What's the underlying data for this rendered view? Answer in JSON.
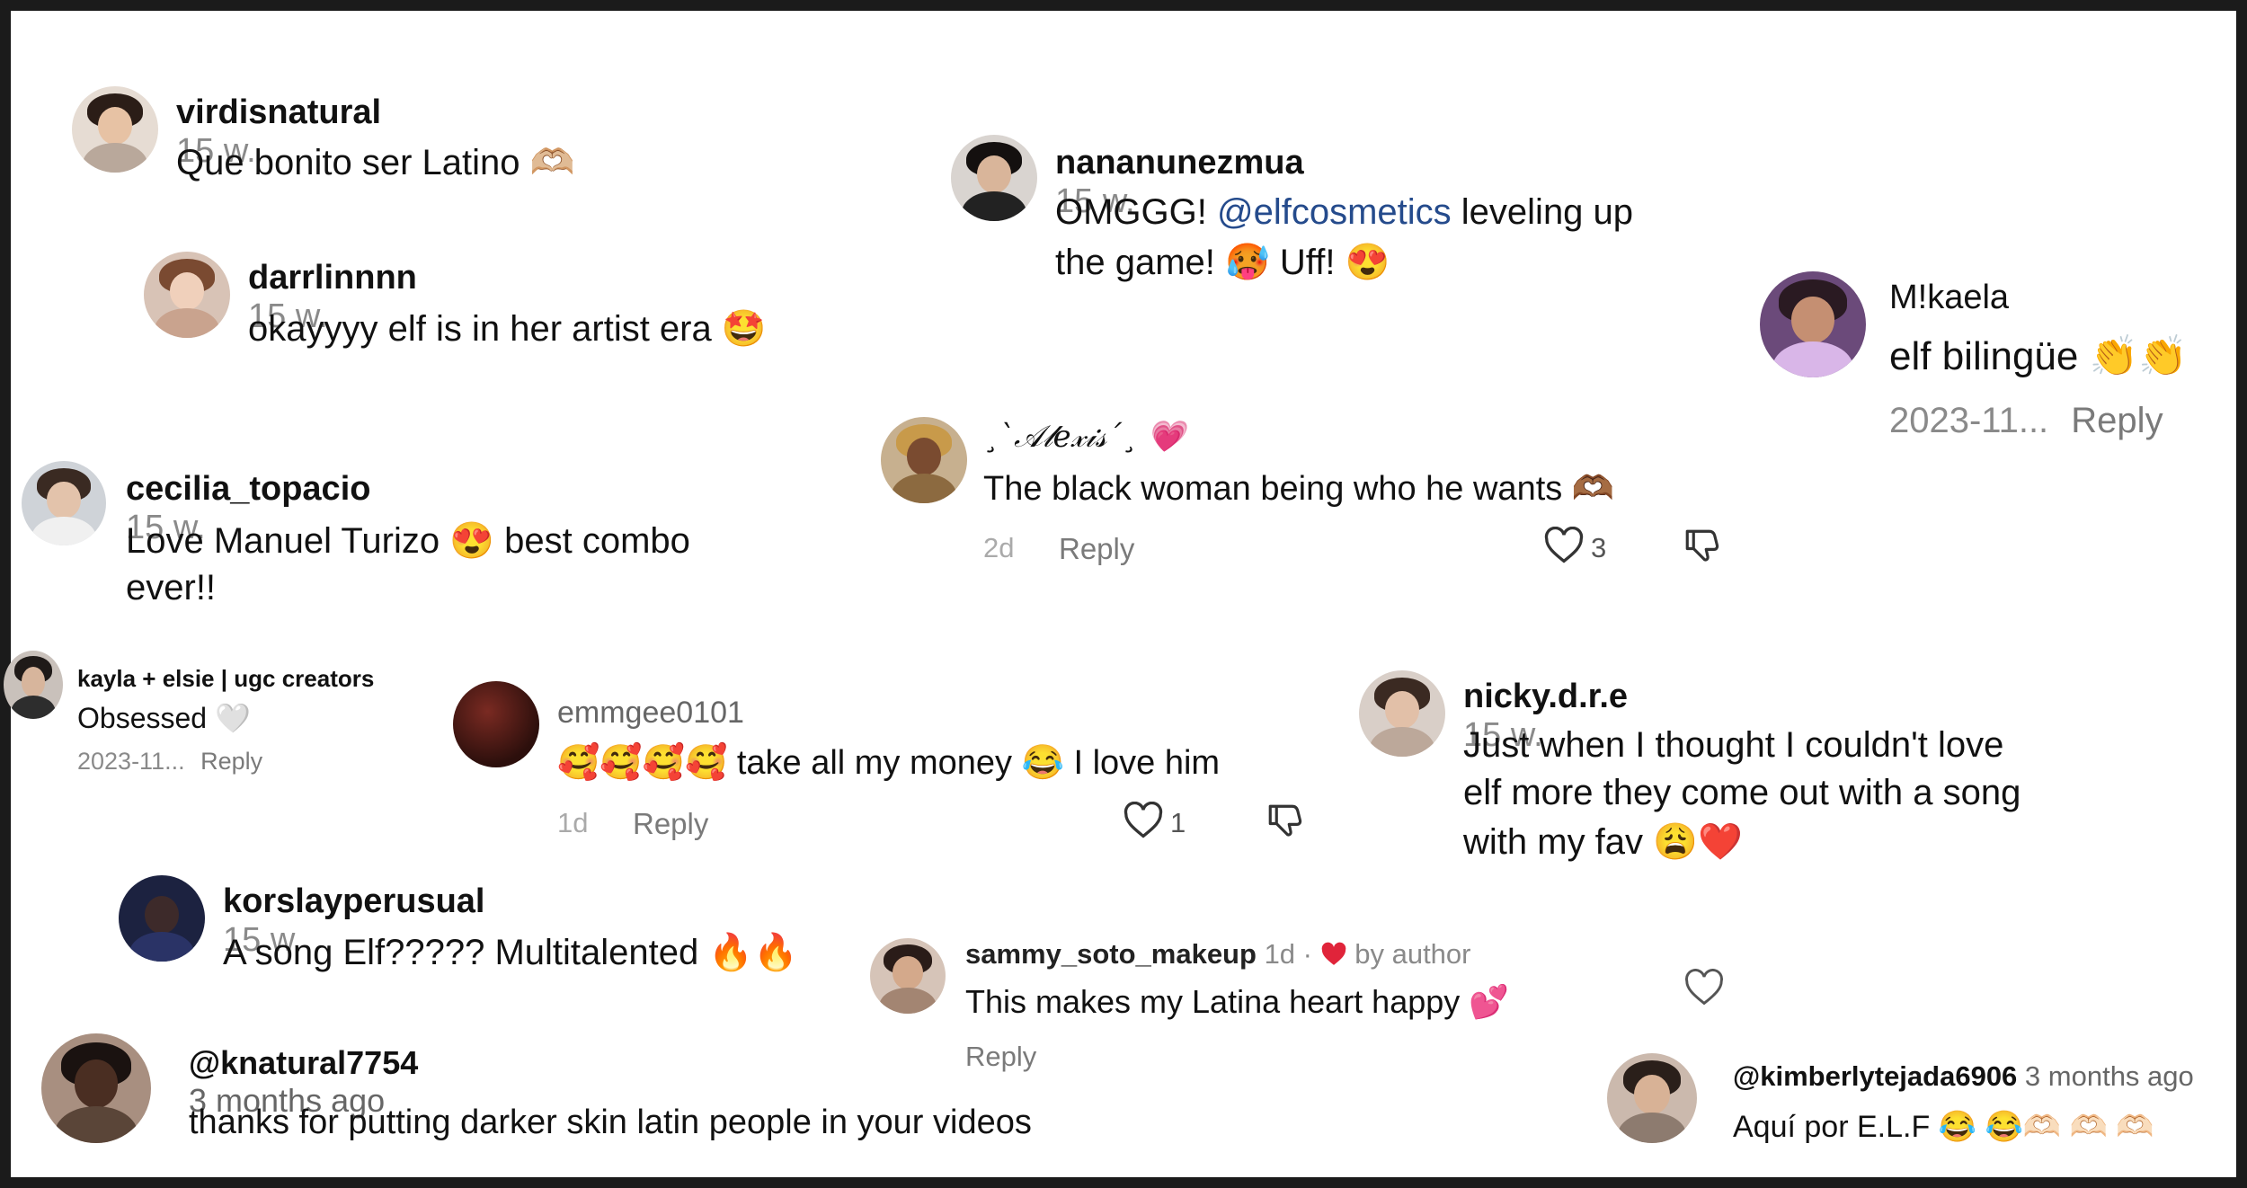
{
  "comments": [
    {
      "user": "virdisnatural",
      "time": "15 w.",
      "text": "Que bonito ser Latino 🫶🏼"
    },
    {
      "user": "darrlinnnn",
      "time": "15 w.",
      "text": "okayyyy elf is in her artist era 🤩"
    },
    {
      "user": "cecilia_topacio",
      "time": "15 w.",
      "line1": "Love Manuel Turizo 😍 best combo",
      "line2": "ever!!"
    },
    {
      "user": "kayla + elsie | ugc creators",
      "text": "Obsessed 🤍",
      "date": "2023-11...",
      "reply": "Reply"
    },
    {
      "user": "emmgee0101",
      "text": "🥰🥰🥰🥰 take all my money 😂 I love him",
      "age": "1d",
      "reply": "Reply",
      "likes": "1"
    },
    {
      "user": "korslayperusual",
      "time": "15 w.",
      "text": "A song Elf????? Multitalented 🔥🔥"
    },
    {
      "user": "@knatural7754",
      "time": "3 months ago",
      "text": "thanks for putting darker skin latin people in your videos"
    },
    {
      "user": "nananunezmua",
      "time": "15 w.",
      "line1_pre": "OMGGG! ",
      "mention": "@elfcosmetics",
      "line1_post": " leveling up",
      "line2": "the game! 🥵 Uff! 😍"
    },
    {
      "user": "¸`𝒜𝓁𝑒𝓍𝒾𝓈´¸ 💗",
      "text": "The black woman being who he wants 🫶🏾",
      "age": "2d",
      "reply": "Reply",
      "likes": "3"
    },
    {
      "user": "sammy_soto_makeup",
      "time": "1d ·",
      "by": "by author",
      "text": "This makes my Latina heart happy 💕",
      "reply": "Reply"
    },
    {
      "user": "M!kaela",
      "text": "elf bilingüe 👏👏",
      "date": "2023-11...",
      "reply": "Reply"
    },
    {
      "user": "nicky.d.r.e",
      "time": "15 w.",
      "line1": "Just when I thought I couldn't love",
      "line2": "elf more they come out with a song",
      "line3": "with my fav 😩❤️"
    },
    {
      "user": "@kimberlytejada6906",
      "time": "3 months ago",
      "text": "Aquí por E.L.F 😂 😂🫶🏻 🫶🏻 🫶🏻"
    }
  ],
  "colors": {
    "frame": "#1b1b1b",
    "muted": "#8a8a8a",
    "mention": "#254b8c",
    "heart_red": "#e0243a"
  },
  "icons": [
    "heart-outline-icon",
    "dislike-icon",
    "heart-filled-icon"
  ]
}
